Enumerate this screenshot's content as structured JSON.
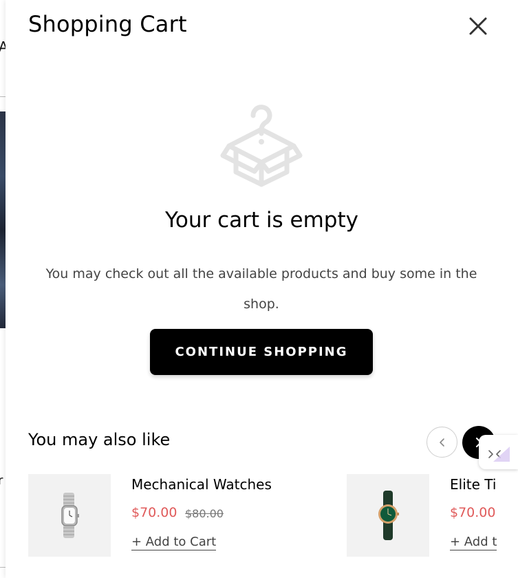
{
  "cart": {
    "title": "Shopping Cart",
    "close_icon": "close-icon",
    "empty": {
      "icon": "empty-box-question-icon",
      "title": "Your cart is empty",
      "message": "You may check out all the available products and buy some in the shop.",
      "button_label": "CONTINUE SHOPPING"
    }
  },
  "recommendations": {
    "title": "You may also like",
    "prev_icon": "chevron-left-icon",
    "next_icon": "chevron-right-icon",
    "products": [
      {
        "name": "Mechanical Watches",
        "price": "$70.00",
        "old_price": "$80.00",
        "add_label": "+ Add to Cart",
        "image": "silver-bracelet-watch"
      },
      {
        "name": "Elite Ti",
        "price": "$70.00",
        "add_label": "+ Add t",
        "image": "green-dial-leather-watch"
      }
    ]
  },
  "colors": {
    "accent_price": "#e05a5a",
    "button_bg": "#000000",
    "icon_gray": "#e3e3e3"
  }
}
